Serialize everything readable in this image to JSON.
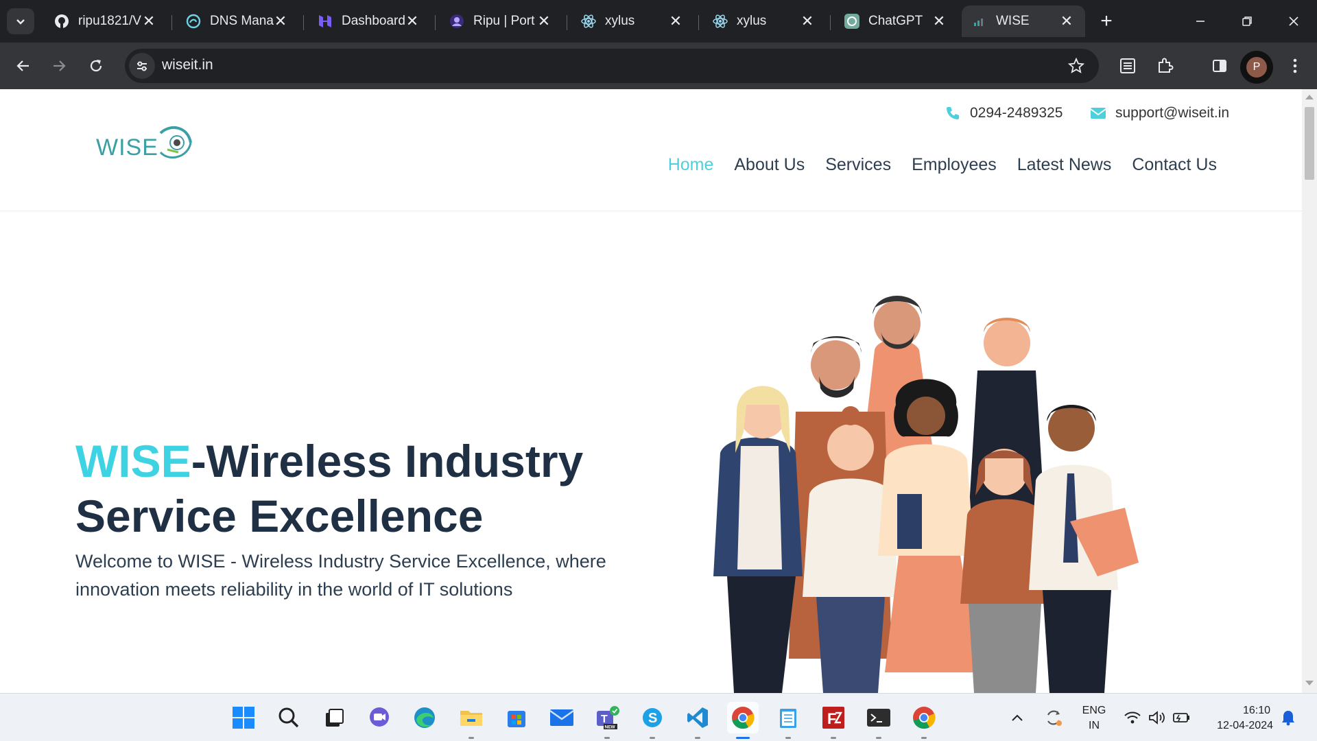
{
  "browser": {
    "tabs": [
      {
        "title": "ripu1821/V",
        "icon": "github-icon"
      },
      {
        "title": "DNS Mana",
        "icon": "dns-icon"
      },
      {
        "title": "Dashboard",
        "icon": "hostinger-icon"
      },
      {
        "title": "Ripu | Port",
        "icon": "portfolio-icon"
      },
      {
        "title": "xylus",
        "icon": "react-icon"
      },
      {
        "title": "xylus",
        "icon": "react-icon"
      },
      {
        "title": "ChatGPT",
        "icon": "chatgpt-icon"
      },
      {
        "title": "WISE",
        "icon": "wise-favicon",
        "active": true
      }
    ],
    "url": "wiseit.in",
    "profile_initial": "P"
  },
  "site": {
    "logo_text": "WISE",
    "phone": "0294-2489325",
    "email": "support@wiseit.in",
    "nav": [
      "Home",
      "About Us",
      "Services",
      "Employees",
      "Latest News",
      "Contact Us"
    ],
    "active_nav": "Home",
    "hero_accent": "WISE",
    "hero_title_rest": "-Wireless Industry Service Excellence",
    "hero_subtitle": "Welcome to WISE - Wireless Industry Service Excellence, where innovation meets reliability in the world of IT solutions",
    "colors": {
      "accent": "#3ed3e3",
      "heading": "#1f3045",
      "logo": "#3aa0a6"
    }
  },
  "taskbar": {
    "apps": [
      "windows-start",
      "search",
      "task-view",
      "chat",
      "edge",
      "file-explorer",
      "store",
      "mail",
      "teams",
      "skype",
      "vscode",
      "chrome",
      "notepad",
      "filezilla",
      "terminal",
      "chrome-alt"
    ],
    "lang_1": "ENG",
    "lang_2": "IN",
    "time": "16:10",
    "date": "12-04-2024"
  }
}
